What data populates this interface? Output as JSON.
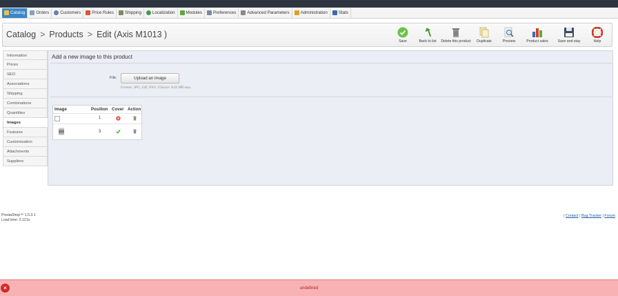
{
  "menu": [
    {
      "label": "Catalog",
      "color": "#f0c040"
    },
    {
      "label": "Orders",
      "color": "#8aa0b8"
    },
    {
      "label": "Customers",
      "color": "#6b7fa8"
    },
    {
      "label": "Price Rules",
      "color": "#d05a3a"
    },
    {
      "label": "Shipping",
      "color": "#7a8c5c"
    },
    {
      "label": "Localization",
      "color": "#4a9a4a"
    },
    {
      "label": "Modules",
      "color": "#5aaa3a"
    },
    {
      "label": "Preferences",
      "color": "#7a8aa0"
    },
    {
      "label": "Advanced Parameters",
      "color": "#8a8a8a"
    },
    {
      "label": "Administration",
      "color": "#e0a020"
    },
    {
      "label": "Stats",
      "color": "#3a6ab0"
    }
  ],
  "breadcrumb": {
    "level1": "Catalog",
    "level2": "Products",
    "level3": "Edit (Axis M1013 )",
    "separator": ">"
  },
  "toolbar": {
    "save": "Save",
    "back": "Back to list",
    "delete": "Delete this product",
    "duplicate": "Duplicate",
    "preview": "Preview",
    "sales": "Product sales",
    "save_stay": "Save and stay",
    "help": "Help"
  },
  "sidebar": {
    "items": [
      {
        "label": "Information"
      },
      {
        "label": "Prices"
      },
      {
        "label": "SEO"
      },
      {
        "label": "Associations"
      },
      {
        "label": "Shipping"
      },
      {
        "label": "Combinations"
      },
      {
        "label": "Quantities"
      },
      {
        "label": "Images"
      },
      {
        "label": "Features"
      },
      {
        "label": "Customization"
      },
      {
        "label": "Attachments"
      },
      {
        "label": "Suppliers"
      }
    ],
    "active": "Images"
  },
  "panel": {
    "title": "Add a new image to this product",
    "file_label": "File:",
    "upload_button": "Upload an image",
    "format_hint": "Format: JPG, GIF, PNG. Filesize: 8.45 MB max."
  },
  "images_table": {
    "headers": {
      "image": "Image",
      "position": "Position",
      "cover": "Cover",
      "action": "Action"
    },
    "rows": [
      {
        "position": "1",
        "cover": false
      },
      {
        "position": "3",
        "cover": true
      }
    ]
  },
  "footer": {
    "version": "PrestaShop™ 1.5.3.1",
    "load_time": "Load time: 2.121s",
    "links": [
      "Contact",
      "Bug Tracker",
      "Forum"
    ],
    "sep": "|"
  },
  "error": {
    "message": "undefined",
    "close": "×"
  },
  "colors": {
    "accent": "#3a87c8",
    "error_bg": "#f8b2b4",
    "error_text": "#b02020"
  }
}
